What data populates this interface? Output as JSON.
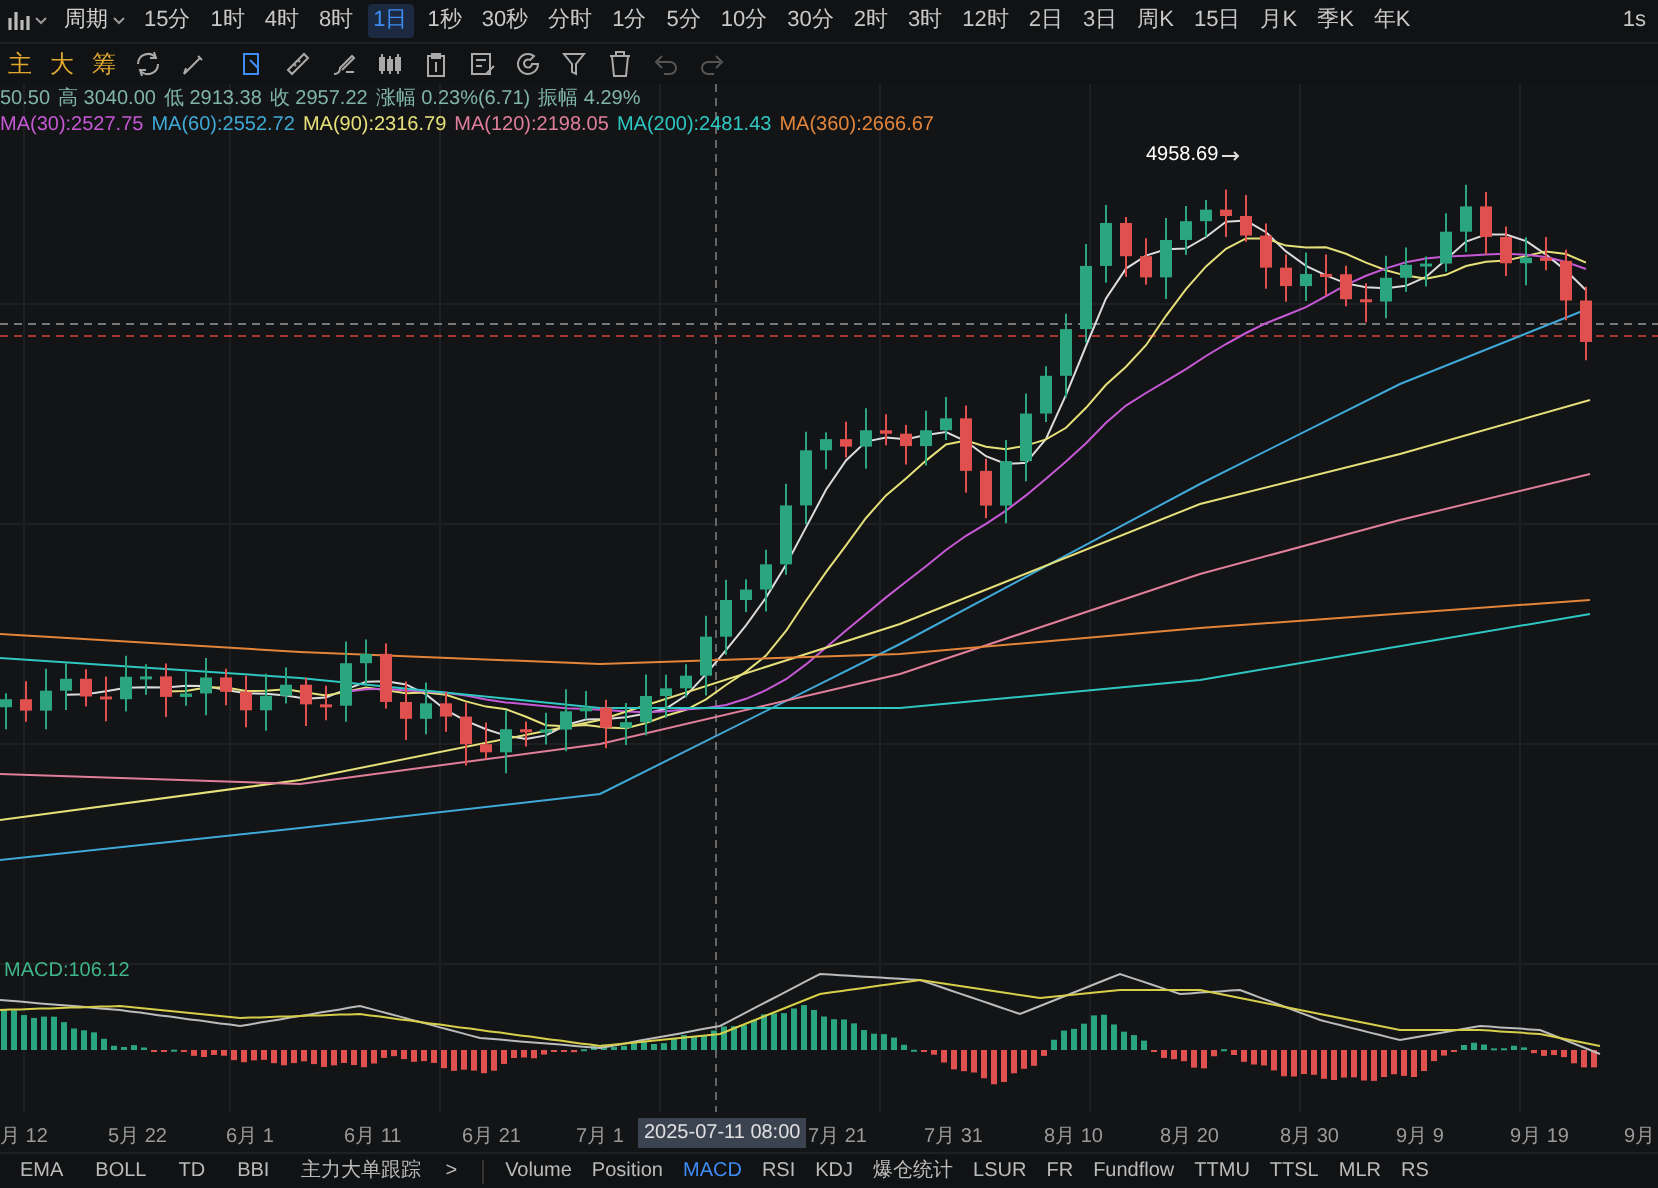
{
  "toolbar": {
    "period_label": "周期",
    "intervals": [
      {
        "label": "15分",
        "selected": false
      },
      {
        "label": "1时",
        "selected": false
      },
      {
        "label": "4时",
        "selected": false
      },
      {
        "label": "8时",
        "selected": false
      },
      {
        "label": "1日",
        "selected": true
      },
      {
        "label": "1秒",
        "selected": false
      },
      {
        "label": "30秒",
        "selected": false
      },
      {
        "label": "分时",
        "selected": false
      },
      {
        "label": "1分",
        "selected": false
      },
      {
        "label": "5分",
        "selected": false
      },
      {
        "label": "10分",
        "selected": false
      },
      {
        "label": "30分",
        "selected": false
      },
      {
        "label": "2时",
        "selected": false
      },
      {
        "label": "3时",
        "selected": false
      },
      {
        "label": "12时",
        "selected": false
      },
      {
        "label": "2日",
        "selected": false
      },
      {
        "label": "3日",
        "selected": false
      },
      {
        "label": "周K",
        "selected": false
      },
      {
        "label": "15日",
        "selected": false
      },
      {
        "label": "月K",
        "selected": false
      },
      {
        "label": "季K",
        "selected": false
      },
      {
        "label": "年K",
        "selected": false
      }
    ],
    "right_label": "1s"
  },
  "quick_buttons": [
    "主",
    "大",
    "筹"
  ],
  "ohlc": [
    "50.50",
    "高 3040.00",
    "低 2913.38",
    "收 2957.22",
    "涨幅 0.23%(6.71)",
    "振幅 4.29%"
  ],
  "ma_legend": [
    {
      "text": "MA(30):2527.75",
      "color": "#c659d6"
    },
    {
      "text": "MA(60):2552.72",
      "color": "#3fa9d8"
    },
    {
      "text": "MA(90):2316.79",
      "color": "#e6e07a"
    },
    {
      "text": "MA(120):2198.05",
      "color": "#e07f9a"
    },
    {
      "text": "MA(200):2481.43",
      "color": "#2fc7c2"
    },
    {
      "text": "MA(360):2666.67",
      "color": "#e3853a"
    }
  ],
  "high_marker": "4958.69",
  "macd_label": "MACD:106.12",
  "x_axis": [
    "月 12",
    "5月 22",
    "6月 1",
    "6月 11",
    "6月 21",
    "7月 1",
    "7月 21",
    "7月 31",
    "8月 10",
    "8月 20",
    "8月 30",
    "9月 9",
    "9月 19",
    "9月"
  ],
  "crosshair_date": "2025-07-11 08:00",
  "main_indicators": [
    "EMA",
    "BOLL",
    "TD",
    "BBI",
    "主力大单跟踪"
  ],
  "more_label": ">",
  "sub_indicators": [
    {
      "label": "Volume",
      "selected": false
    },
    {
      "label": "Position",
      "selected": false
    },
    {
      "label": "MACD",
      "selected": true
    },
    {
      "label": "RSI",
      "selected": false
    },
    {
      "label": "KDJ",
      "selected": false
    },
    {
      "label": "爆仓统计",
      "selected": false
    },
    {
      "label": "LSUR",
      "selected": false
    },
    {
      "label": "FR",
      "selected": false
    },
    {
      "label": "Fundflow",
      "selected": false
    },
    {
      "label": "TTMU",
      "selected": false
    },
    {
      "label": "TTSL",
      "selected": false
    },
    {
      "label": "MLR",
      "selected": false
    },
    {
      "label": "RS",
      "selected": false
    }
  ]
}
